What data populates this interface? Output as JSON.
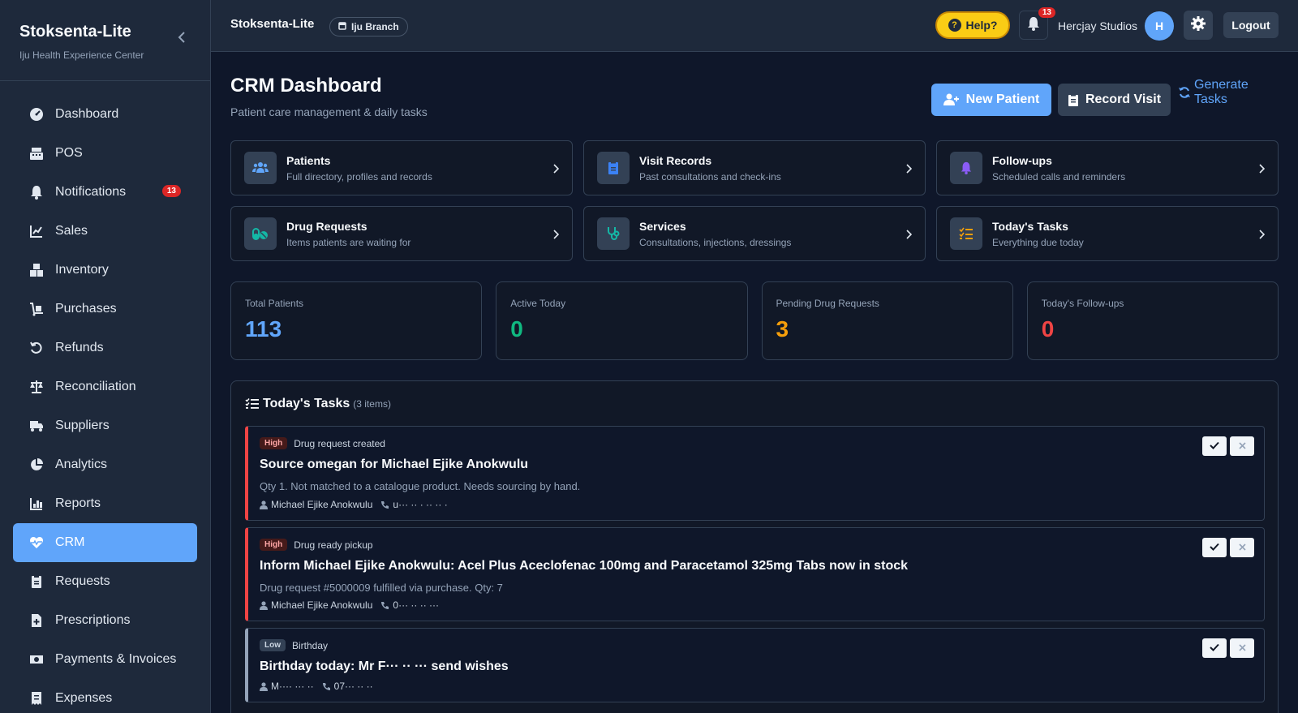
{
  "sidebar": {
    "title": "Stoksenta-Lite",
    "subtitle": "Iju Health Experience Center",
    "items": [
      {
        "label": "Dashboard",
        "icon": "gauge-icon"
      },
      {
        "label": "POS",
        "icon": "cash-register-icon"
      },
      {
        "label": "Notifications",
        "icon": "bell-icon",
        "badge": "13"
      },
      {
        "label": "Sales",
        "icon": "chart-line-icon"
      },
      {
        "label": "Inventory",
        "icon": "boxes-icon"
      },
      {
        "label": "Purchases",
        "icon": "dolly-icon"
      },
      {
        "label": "Refunds",
        "icon": "undo-icon"
      },
      {
        "label": "Reconciliation",
        "icon": "scale-icon"
      },
      {
        "label": "Suppliers",
        "icon": "truck-icon"
      },
      {
        "label": "Analytics",
        "icon": "pie-chart-icon"
      },
      {
        "label": "Reports",
        "icon": "bar-chart-icon"
      },
      {
        "label": "CRM",
        "icon": "heart-pulse-icon",
        "active": true
      },
      {
        "label": "Requests",
        "icon": "clipboard-icon"
      },
      {
        "label": "Prescriptions",
        "icon": "file-medical-icon"
      },
      {
        "label": "Payments & Invoices",
        "icon": "money-icon"
      },
      {
        "label": "Expenses",
        "icon": "receipt-icon"
      }
    ]
  },
  "topbar": {
    "title": "Stoksenta-Lite",
    "branch": "Iju Branch",
    "help": "Help?",
    "notif_count": "13",
    "user": "Hercjay Studios",
    "avatar_initial": "H",
    "logout": "Logout"
  },
  "page": {
    "title": "CRM Dashboard",
    "subtitle": "Patient care management & daily tasks",
    "new_patient": "New Patient",
    "record_visit": "Record Visit",
    "generate_tasks": "Generate Tasks"
  },
  "quick_cards": [
    {
      "title": "Patients",
      "subtitle": "Full directory, profiles and records",
      "icon": "users-icon",
      "color": "#60a5fa"
    },
    {
      "title": "Visit Records",
      "subtitle": "Past consultations and check-ins",
      "icon": "clipboard-list-icon",
      "color": "#3b82f6"
    },
    {
      "title": "Follow-ups",
      "subtitle": "Scheduled calls and reminders",
      "icon": "bell-icon",
      "color": "#8b5cf6"
    },
    {
      "title": "Drug Requests",
      "subtitle": "Items patients are waiting for",
      "icon": "pills-icon",
      "color": "#14b8a6"
    },
    {
      "title": "Services",
      "subtitle": "Consultations, injections, dressings",
      "icon": "stethoscope-icon",
      "color": "#14b8a6"
    },
    {
      "title": "Today's Tasks",
      "subtitle": "Everything due today",
      "icon": "tasks-icon",
      "color": "#f59e0b"
    }
  ],
  "stats": [
    {
      "label": "Total Patients",
      "value": "113",
      "color": "#60a5fa"
    },
    {
      "label": "Active Today",
      "value": "0",
      "color": "#10b981"
    },
    {
      "label": "Pending Drug Requests",
      "value": "3",
      "color": "#f59e0b"
    },
    {
      "label": "Today's Follow-ups",
      "value": "0",
      "color": "#ef4444"
    }
  ],
  "tasks": {
    "heading": "Today's Tasks",
    "count": "(3 items)",
    "items": [
      {
        "priority": "High",
        "kind": "Drug request created",
        "title": "Source omegan for Michael Ejike Anokwulu",
        "desc": "Qty 1. Not matched to a catalogue product. Needs sourcing by hand.",
        "patient": "Michael Ejike Anokwulu",
        "phone": "u··· ·· · ·· ·· ·"
      },
      {
        "priority": "High",
        "kind": "Drug ready pickup",
        "title": "Inform Michael Ejike Anokwulu: Acel Plus Aceclofenac 100mg and Paracetamol 325mg Tabs now in stock",
        "desc": "Drug request #5000009 fulfilled via purchase. Qty: 7",
        "patient": "Michael Ejike Anokwulu",
        "phone": "0··· ·· ·· ···"
      },
      {
        "priority": "Low",
        "kind": "Birthday",
        "title": "Birthday today: Mr F··· ·· ··· send wishes",
        "desc": "",
        "patient": "M···· ··· ··",
        "phone": "07··· ·· ··"
      }
    ]
  }
}
